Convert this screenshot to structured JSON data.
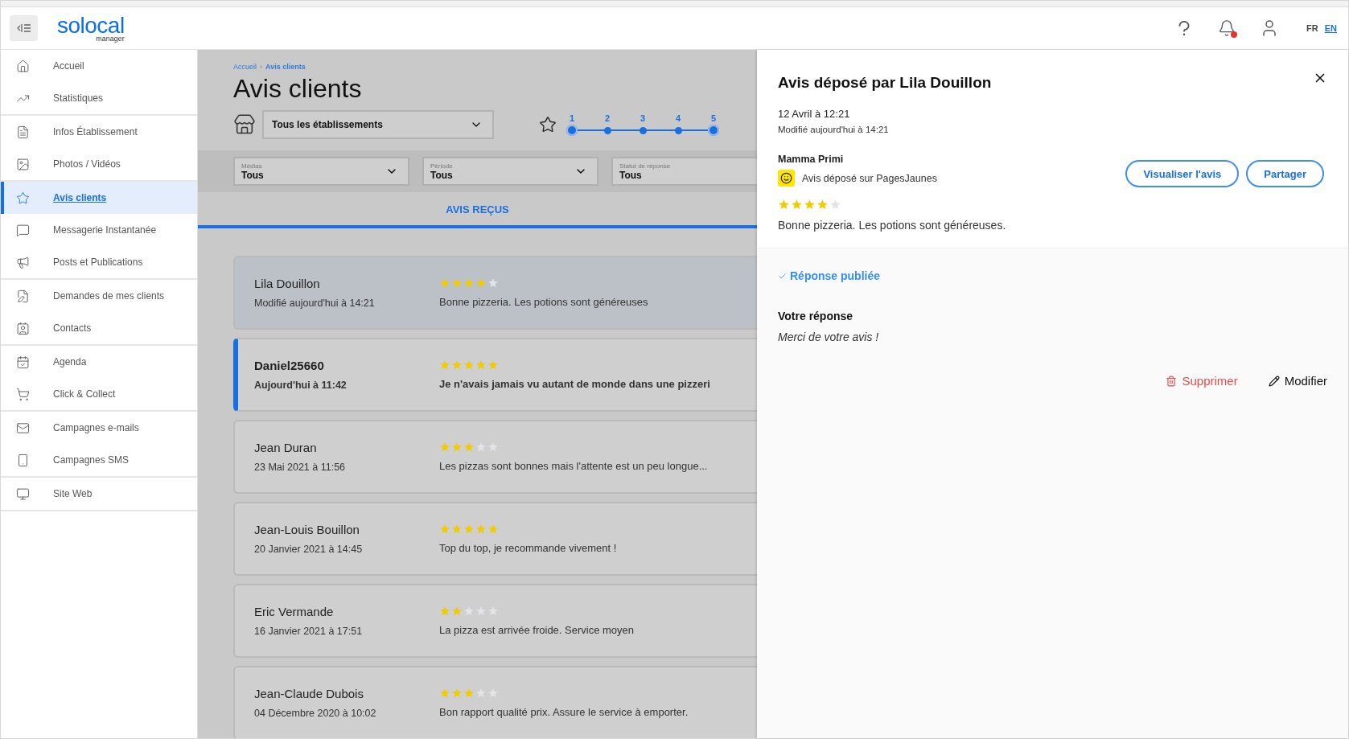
{
  "header": {
    "logo": "solocal",
    "logo_sub": "manager",
    "notifications_unread": true,
    "languages": [
      {
        "label": "FR",
        "selected": false
      },
      {
        "label": "EN",
        "selected": true
      }
    ]
  },
  "sidebar": {
    "groups": [
      {
        "items": [
          {
            "label": "Accueil",
            "selected": false
          },
          {
            "label": "Statistiques",
            "selected": false
          }
        ]
      },
      {
        "items": [
          {
            "label": "Infos Établissement",
            "selected": false
          },
          {
            "label": "Photos / Vidéos",
            "selected": false
          }
        ]
      },
      {
        "items": [
          {
            "label": "Avis clients",
            "selected": true
          },
          {
            "label": "Messagerie Instantanée",
            "selected": false
          },
          {
            "label": "Posts et Publications",
            "selected": false
          }
        ]
      },
      {
        "items": [
          {
            "label": "Demandes de mes clients",
            "selected": false
          },
          {
            "label": "Contacts",
            "selected": false
          }
        ]
      },
      {
        "items": [
          {
            "label": "Agenda",
            "selected": false
          },
          {
            "label": "Click & Collect",
            "selected": false
          }
        ]
      },
      {
        "items": [
          {
            "label": "Campagnes e-mails",
            "selected": false
          },
          {
            "label": "Campagnes SMS",
            "selected": false
          }
        ]
      },
      {
        "items": [
          {
            "label": "Site Web",
            "selected": false
          }
        ]
      }
    ]
  },
  "breadcrumb_separator": "›",
  "breadcrumb": [
    {
      "label": "Accueil",
      "selected": false
    },
    {
      "label": "Avis clients",
      "selected": true
    }
  ],
  "page_title": "Avis clients",
  "establishment_select": {
    "value": "Tous les établissements"
  },
  "rating_filter": {
    "steps": [
      {
        "label": "1",
        "selected": true
      },
      {
        "label": "2",
        "selected": false
      },
      {
        "label": "3",
        "selected": false
      },
      {
        "label": "4",
        "selected": false
      },
      {
        "label": "5",
        "selected": true
      }
    ]
  },
  "filters": [
    {
      "label": "Médias",
      "value": "Tous"
    },
    {
      "label": "Période",
      "value": "Tous"
    },
    {
      "label": "Statut de réponse",
      "value": "Tous"
    }
  ],
  "tabs": [
    {
      "label": "AVIS REÇUS",
      "selected": true
    }
  ],
  "reviews": [
    {
      "author": "Lila Douillon",
      "date": "Modifié aujourd'hui à 14:21",
      "stars": 4,
      "text": "Bonne pizzeria. Les potions sont généreuses",
      "selected": true,
      "unread": false
    },
    {
      "author": "Daniel25660",
      "date": "Aujourd'hui à 11:42",
      "stars": 5,
      "text": "Je n'avais jamais vu autant de monde dans une pizzeri",
      "selected": false,
      "unread": true
    },
    {
      "author": "Jean Duran",
      "date": "23 Mai 2021 à 11:56",
      "stars": 3,
      "text": "Les pizzas sont bonnes mais l'attente est un peu longue...",
      "selected": false,
      "unread": false
    },
    {
      "author": "Jean-Louis Bouillon",
      "date": "20 Janvier 2021 à 14:45",
      "stars": 5,
      "text": "Top du top, je recommande vivement !",
      "selected": false,
      "unread": false
    },
    {
      "author": "Eric Vermande",
      "date": "16 Janvier 2021 à 17:51",
      "stars": 2,
      "text": "La pizza est arrivée froide. Service moyen",
      "selected": false,
      "unread": false
    },
    {
      "author": "Jean-Claude Dubois",
      "date": "04 Décembre 2020 à 10:02",
      "stars": 3,
      "text": "Bon rapport qualité prix. Assure le service à emporter.",
      "selected": false,
      "unread": false
    }
  ],
  "detail": {
    "title": "Avis déposé par Lila Douillon",
    "date": "12 Avril à 12:21",
    "modified": "Modifié aujourd'hui à 14:21",
    "establishment": "Mamma Primi",
    "source": "Avis déposé sur PagesJaunes",
    "buttons": [
      "Visualiser l'avis",
      "Partager"
    ],
    "stars": 4,
    "text": "Bonne pizzeria. Les potions sont généreuses.",
    "response_status": "Réponse publiée",
    "response_heading": "Votre réponse",
    "response_text": "Merci de votre avis !",
    "actions": [
      {
        "label": "Supprimer",
        "kind": "delete"
      },
      {
        "label": "Modifier",
        "kind": "edit"
      }
    ]
  }
}
